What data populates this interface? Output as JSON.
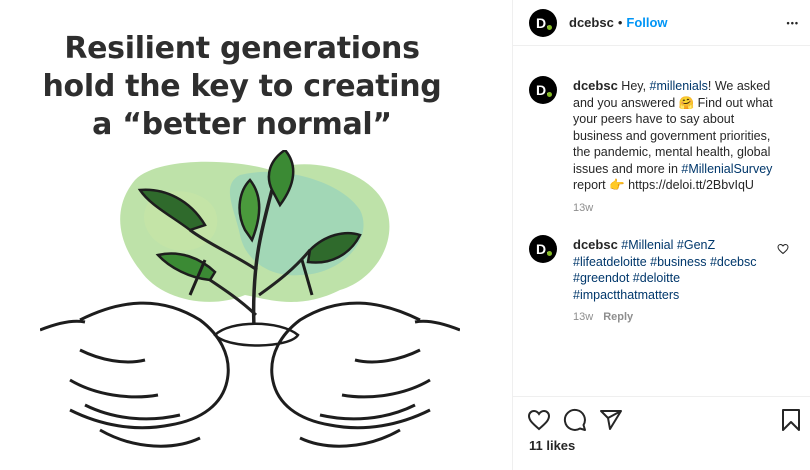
{
  "post_image": {
    "headline_lines": [
      "Resilient generations",
      "hold the key to creating",
      "a “better normal”"
    ]
  },
  "header": {
    "avatar_letter": "D.",
    "username": "dcebsc",
    "separator": "•",
    "follow_label": "Follow",
    "more_label": "•••"
  },
  "caption": {
    "username": "dcebsc",
    "parts": [
      {
        "text": "Hey, ",
        "tag": false
      },
      {
        "text": "#millenials",
        "tag": true
      },
      {
        "text": "! We asked and you answered 🤗 Find out what your peers have to say about business and government priorities, the pandemic, mental health, global issues and more in ",
        "tag": false
      },
      {
        "text": "#MillenialSurvey",
        "tag": true
      },
      {
        "text": " report 👉 https://deloi.tt/2BbvIqU",
        "tag": false
      }
    ],
    "time": "13w"
  },
  "comment": {
    "username": "dcebsc",
    "parts": [
      {
        "text": "#Millenial",
        "tag": true
      },
      {
        "text": " ",
        "tag": false
      },
      {
        "text": "#GenZ",
        "tag": true
      },
      {
        "text": " ",
        "tag": false
      },
      {
        "text": "#lifeatdeloitte",
        "tag": true
      },
      {
        "text": " ",
        "tag": false
      },
      {
        "text": "#business",
        "tag": true
      },
      {
        "text": " ",
        "tag": false
      },
      {
        "text": "#dcebsc",
        "tag": true
      },
      {
        "text": " ",
        "tag": false
      },
      {
        "text": "#greendot",
        "tag": true
      },
      {
        "text": " ",
        "tag": false
      },
      {
        "text": "#deloitte",
        "tag": true
      },
      {
        "text": " ",
        "tag": false
      },
      {
        "text": "#impactthatmatters",
        "tag": true
      }
    ],
    "time": "13w",
    "reply_label": "Reply"
  },
  "actions": {
    "like_icon": "heart-icon",
    "comment_icon": "comment-icon",
    "share_icon": "share-icon",
    "save_icon": "bookmark-icon",
    "likes_text": "11 likes"
  },
  "colors": {
    "link": "#0095f6",
    "hashtag": "#00376b",
    "muted": "#8e8e8e",
    "brand_dot": "#86bc25"
  }
}
